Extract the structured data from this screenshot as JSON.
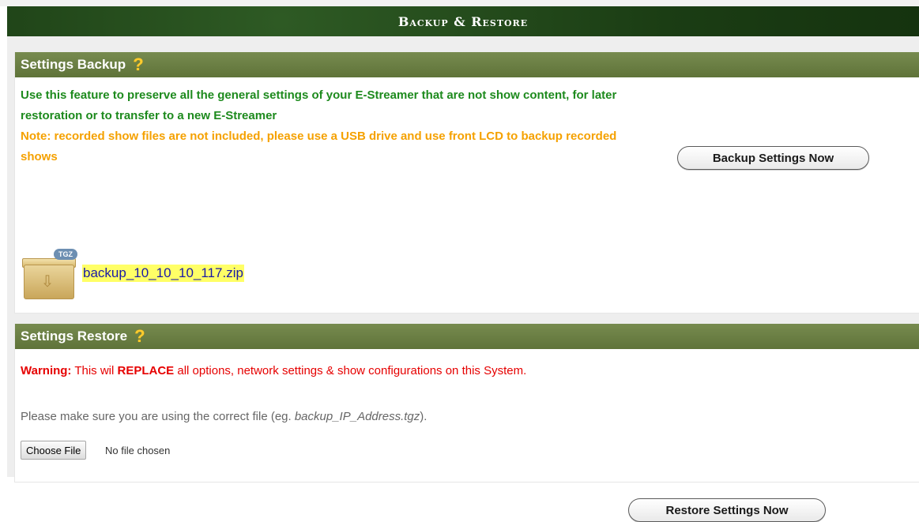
{
  "page": {
    "title": "Backup & Restore"
  },
  "backup": {
    "title": "Settings Backup",
    "help": "?",
    "desc_green": "Use this feature to preserve all the general settings of your E-Streamer that are not show content, for later restoration or to transfer to a new E-Streamer",
    "desc_orange": "Note: recorded show files are not included, please use a USB drive and use front LCD to backup recorded shows",
    "button_label": "Backup Settings Now",
    "file": {
      "badge": "TGZ",
      "name": "backup_10_10_10_117.zip",
      "icon": "tgz-archive-icon"
    }
  },
  "restore": {
    "title": "Settings Restore",
    "help": "?",
    "warning_label": "Warning:",
    "warning_pre": " This wil ",
    "warning_replace": "REPLACE",
    "warning_post": " all options, network settings & show configurations on this System.",
    "info_pre": "Please make sure you are using the correct file (eg. ",
    "info_example": "backup_IP_Address.tgz",
    "info_post": ").",
    "choose_file_label": "Choose File",
    "no_file_text": "No file chosen",
    "button_label": "Restore Settings Now"
  },
  "colors": {
    "title_bar": "#1e4417",
    "section_head": "#6b7f45",
    "help_icon": "#ffcc2e",
    "green_text": "#1d8a1d",
    "orange_text": "#f5a100",
    "warning_text": "#e60000",
    "file_highlight": "#ffff66"
  }
}
